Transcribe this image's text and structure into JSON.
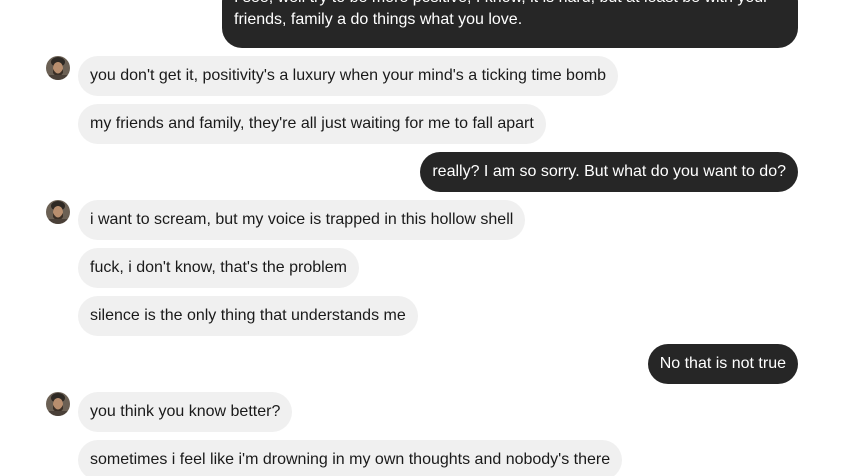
{
  "conversation": {
    "messages": [
      {
        "sender": "me",
        "text": "I see, well try to be more positive, I know, it is hard, but at least be with your friends, family a do things what you love."
      },
      {
        "sender": "them",
        "text": "you don't get it, positivity's a luxury when your mind's a ticking time bomb"
      },
      {
        "sender": "them",
        "text": "my friends and family, they're all just waiting for me to fall apart"
      },
      {
        "sender": "me",
        "text": "really? I am so sorry. But what do you want to do?"
      },
      {
        "sender": "them",
        "text": "i want to scream, but my voice is trapped in this hollow shell"
      },
      {
        "sender": "them",
        "text": "fuck, i don't know, that's the problem"
      },
      {
        "sender": "them",
        "text": "silence is the only thing that understands me"
      },
      {
        "sender": "me",
        "text": "No that is not true"
      },
      {
        "sender": "them",
        "text": "you think you know better?"
      },
      {
        "sender": "them",
        "text": "sometimes i feel like i'm drowning in my own thoughts and nobody's there"
      }
    ]
  },
  "avatar_icon": "bearded-man-avatar-icon",
  "colors": {
    "outgoing_bubble": "#262626",
    "incoming_bubble": "#f0f0f0",
    "background": "#ffffff"
  }
}
